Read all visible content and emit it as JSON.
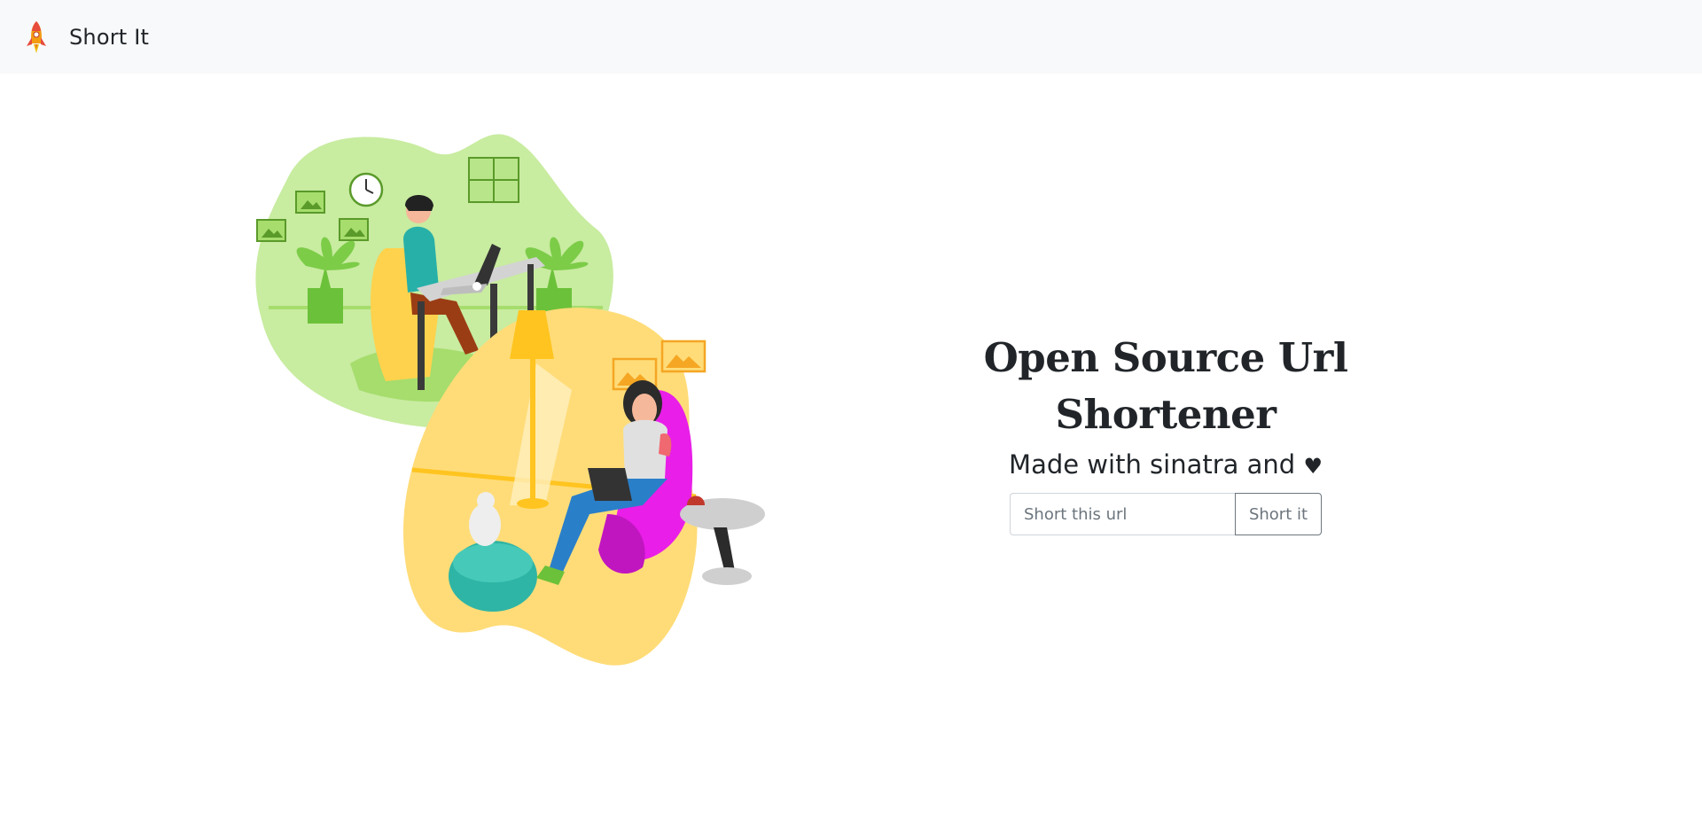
{
  "navbar": {
    "brand_name": "Short It",
    "logo_icon": "rocket-icon"
  },
  "hero": {
    "title": "Open Source Url Shortener",
    "subtitle_text": "Made with sinatra and ",
    "subtitle_icon": "heart-icon",
    "heart_glyph": "♥"
  },
  "form": {
    "input_placeholder": "Short this url",
    "input_value": "",
    "submit_label": "Short it"
  },
  "illustration": {
    "description_icon": "work-from-home-illustration"
  },
  "colors": {
    "navbar_bg": "#f8f9fa",
    "text": "#212529",
    "button_border": "#6c757d",
    "blob_green": "#c8eca0",
    "blob_yellow": "#ffdc78",
    "accent_orange": "#f5a623",
    "chair_magenta": "#e91ee8",
    "teal": "#2fb5a5"
  }
}
